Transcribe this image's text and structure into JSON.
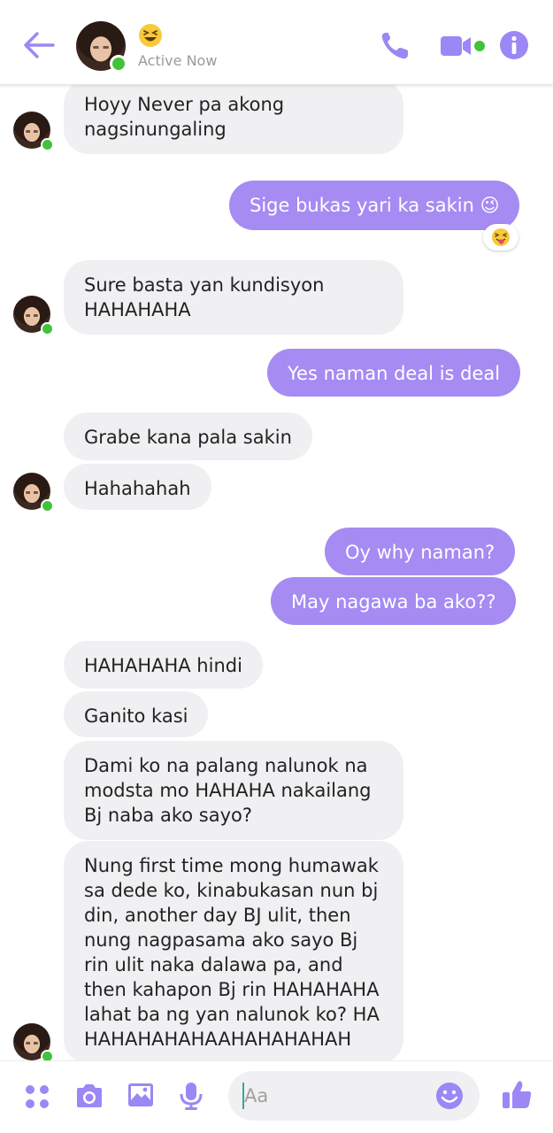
{
  "header": {
    "contact_status_emoji": "laughing-emoji",
    "active_status": "Active Now",
    "accent_color": "#9b87f5",
    "online_color": "#42c23a"
  },
  "messages": [
    {
      "direction": "in",
      "text": "Hoyy Never pa akong nagsinungaling"
    },
    {
      "direction": "out",
      "text": "Sige bukas yari ka sakin 😉",
      "reaction": "tongue-out-emoji"
    },
    {
      "direction": "in",
      "text": "Sure basta yan kundisyon HAHAHAHA"
    },
    {
      "direction": "out",
      "text": "Yes naman deal is deal"
    },
    {
      "direction": "in",
      "text": "Grabe kana pala sakin"
    },
    {
      "direction": "in",
      "text": "Hahahahah"
    },
    {
      "direction": "out",
      "text": "Oy why naman?"
    },
    {
      "direction": "out",
      "text": "May nagawa ba ako??"
    },
    {
      "direction": "in",
      "text": "HAHAHAHA hindi"
    },
    {
      "direction": "in",
      "text": "Ganito kasi"
    },
    {
      "direction": "in",
      "text": "Dami ko na palang nalunok na modsta mo HAHAHA nakailang Bj naba ako sayo?"
    },
    {
      "direction": "in",
      "text": "Nung first time mong humawak sa dede ko, kinabukasan nun bj din, another day BJ ulit, then nung nagpasama ako sayo Bj rin ulit naka dalawa pa, and then kahapon Bj rin HAHAHAHA lahat ba ng yan nalunok ko? HA HAHAHAHAHAAHAHAHAHAH"
    }
  ],
  "composer": {
    "placeholder": "Aa",
    "tools": [
      "apps-grid-icon",
      "camera-icon",
      "gallery-icon",
      "microphone-icon"
    ],
    "emoji_icon": "smiley-icon",
    "send_icon": "thumbs-up-icon"
  }
}
